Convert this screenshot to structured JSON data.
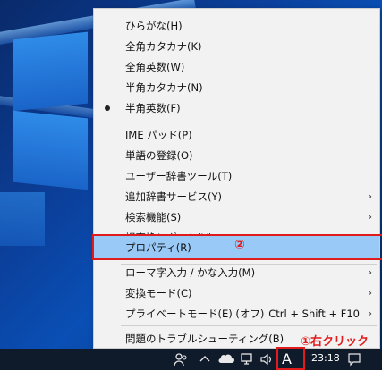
{
  "menu": {
    "items": [
      {
        "label": "ひらがな(H)"
      },
      {
        "label": "全角カタカナ(K)"
      },
      {
        "label": "全角英数(W)"
      },
      {
        "label": "半角カタカナ(N)"
      },
      {
        "label": "半角英数(F)",
        "checked": true
      },
      {
        "label": "IME パッド(P)"
      },
      {
        "label": "単語の登録(O)"
      },
      {
        "label": "ユーザー辞書ツール(T)"
      },
      {
        "label": "追加辞書サービス(Y)",
        "submenu": true
      },
      {
        "label": "検索機能(S)",
        "submenu": true
      },
      {
        "label": "誤変換レポート(V)"
      },
      {
        "label": "プロパティ(R)",
        "highlighted": true
      },
      {
        "label": "ローマ字入力 / かな入力(M)",
        "submenu": true
      },
      {
        "label": "変換モード(C)",
        "submenu": true
      },
      {
        "label": "プライベートモード(E) (オフ)",
        "shortcut": "Ctrl + Shift + F10",
        "submenu": true
      },
      {
        "label": "問題のトラブルシューティング(B)"
      }
    ],
    "submenu_arrow": "›"
  },
  "annotations": {
    "step2": "②",
    "step1": "①右クリック",
    "color": "#e01b1b"
  },
  "taskbar": {
    "ime_indicator": "A",
    "time": "23:18",
    "icons": [
      "people-icon",
      "chevron-up-icon",
      "onedrive-icon",
      "network-icon",
      "volume-icon",
      "notification-icon"
    ]
  },
  "colors": {
    "highlight": "#99c9f6",
    "menu_bg": "#f2f2f2",
    "taskbar_bg": "#0f1a2a"
  }
}
